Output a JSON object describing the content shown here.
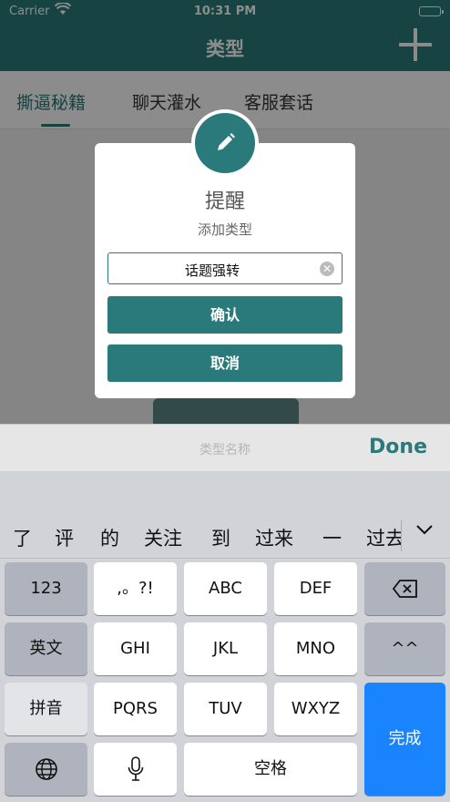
{
  "status_bar": {
    "carrier": "Carrier",
    "time": "10:31 PM"
  },
  "nav": {
    "title": "类型"
  },
  "tabs": [
    "撕逼秘籍",
    "聊天灌水",
    "客服套话"
  ],
  "alert": {
    "title": "提醒",
    "message": "添加类型",
    "input_value": "话题强转",
    "confirm_label": "确认",
    "cancel_label": "取消"
  },
  "toolbar": {
    "placeholder": "类型名称",
    "done_label": "Done"
  },
  "keyboard": {
    "candidates": [
      "了",
      "评",
      "的",
      "关注",
      "到",
      "过来",
      "一",
      "过去"
    ],
    "keys": {
      "num": "123",
      "punct": ",。?!",
      "abc": "ABC",
      "def": "DEF",
      "english": "英文",
      "ghi": "GHI",
      "jkl": "JKL",
      "mno": "MNO",
      "emoji": "^^",
      "pinyin": "拼音",
      "pqrs": "PQRS",
      "tuv": "TUV",
      "wxyz": "WXYZ",
      "done": "完成",
      "space": "空格"
    }
  },
  "colors": {
    "accent": "#2b7a7b",
    "keyboard_blue": "#1a84ff"
  }
}
